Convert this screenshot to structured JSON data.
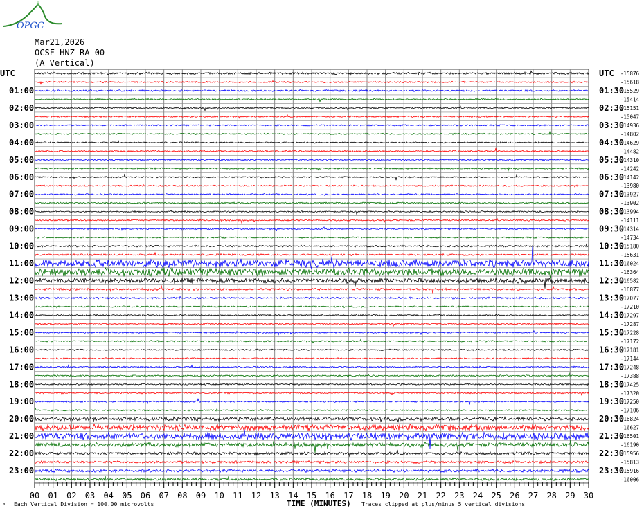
{
  "logo_text": "OPGC",
  "header": {
    "date": "Mar21,2026",
    "station": "OCSF HNZ RA 00",
    "component": "(A Vertical)"
  },
  "chart_data": {
    "type": "line",
    "title": "Helicorder seismogram",
    "xlabel": "TIME (MINUTES)",
    "x_ticks": [
      "00",
      "01",
      "02",
      "03",
      "04",
      "05",
      "06",
      "07",
      "08",
      "09",
      "10",
      "11",
      "12",
      "13",
      "14",
      "15",
      "16",
      "17",
      "18",
      "19",
      "20",
      "21",
      "22",
      "23",
      "24",
      "25",
      "26",
      "27",
      "28",
      "29",
      "30"
    ],
    "xlim": [
      0,
      30
    ],
    "left_labels": [
      "UTC",
      "01:00",
      "02:00",
      "03:00",
      "04:00",
      "05:00",
      "06:00",
      "07:00",
      "08:00",
      "09:00",
      "10:00",
      "11:00",
      "12:00",
      "13:00",
      "14:00",
      "15:00",
      "16:00",
      "17:00",
      "18:00",
      "19:00",
      "20:00",
      "21:00",
      "22:00",
      "23:00"
    ],
    "right_labels": [
      "UTC",
      "01:30",
      "02:30",
      "03:30",
      "04:30",
      "05:30",
      "06:30",
      "07:30",
      "08:30",
      "09:30",
      "10:30",
      "11:30",
      "12:30",
      "13:30",
      "14:30",
      "15:30",
      "16:30",
      "17:30",
      "18:30",
      "19:30",
      "20:30",
      "21:30",
      "22:30",
      "23:30"
    ],
    "trace_offsets": [
      -15876,
      -15618,
      -15529,
      -15414,
      -15151,
      -15047,
      -14936,
      -14802,
      -14629,
      -14482,
      -14310,
      -14242,
      -14142,
      -13980,
      -13927,
      -13902,
      -13994,
      -14111,
      -14314,
      -14734,
      -15180,
      -15631,
      -16024,
      -16364,
      -16582,
      -16877,
      -17077,
      -17210,
      -17297,
      -17287,
      -17228,
      -17172,
      -17181,
      -17144,
      -17248,
      -17388,
      -17425,
      -17320,
      -17250,
      -17106,
      -16824,
      -16627,
      -16501,
      -16190,
      -15956,
      -15813,
      -15916,
      -16006
    ],
    "trace_colors": [
      "#000000",
      "#ff0000",
      "#0000ff",
      "#007000"
    ],
    "relative_amplitude": [
      0.6,
      0.4,
      0.5,
      0.4,
      0.4,
      0.4,
      0.4,
      0.4,
      0.4,
      0.4,
      0.4,
      0.4,
      0.4,
      0.4,
      0.4,
      0.4,
      0.4,
      0.4,
      0.4,
      0.4,
      0.5,
      0.5,
      2.2,
      2.2,
      1.4,
      0.6,
      0.5,
      0.4,
      0.4,
      0.4,
      0.4,
      0.4,
      0.4,
      0.4,
      0.4,
      0.4,
      0.4,
      0.4,
      0.4,
      0.4,
      1.0,
      1.6,
      2.0,
      1.2,
      0.8,
      0.7,
      0.8,
      0.7
    ],
    "grid": true,
    "scale_note": "Each Vertical Division =  100.00 microvolts",
    "clip_note": "Traces clipped at plus/minus 5 vertical divisions"
  }
}
